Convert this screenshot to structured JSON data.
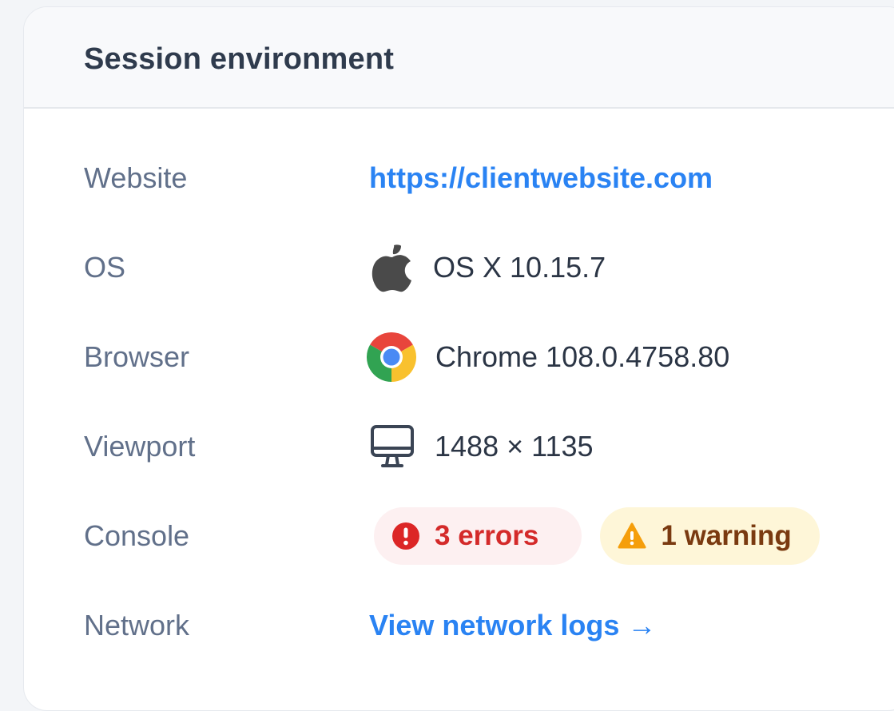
{
  "panel": {
    "title": "Session environment"
  },
  "rows": {
    "website": {
      "label": "Website",
      "value": "https://clientwebsite.com"
    },
    "os": {
      "label": "OS",
      "icon": "apple-icon",
      "value": "OS X 10.15.7"
    },
    "browser": {
      "label": "Browser",
      "icon": "chrome-icon",
      "value": "Chrome 108.0.4758.80"
    },
    "viewport": {
      "label": "Viewport",
      "icon": "monitor-icon",
      "value": "1488 × 1135"
    },
    "console": {
      "label": "Console",
      "errors": {
        "icon": "error-icon",
        "text": "3 errors",
        "color": "#d42a2a",
        "background": "#fdf0f1"
      },
      "warnings": {
        "icon": "warning-icon",
        "text": "1 warning",
        "color": "#7a3a10",
        "background": "#fef6d8"
      }
    },
    "network": {
      "label": "Network",
      "link": "View network logs →"
    }
  },
  "colors": {
    "link": "#2a83f3",
    "label": "#61708a",
    "value": "#2b3545",
    "title": "#2f3b4d"
  }
}
